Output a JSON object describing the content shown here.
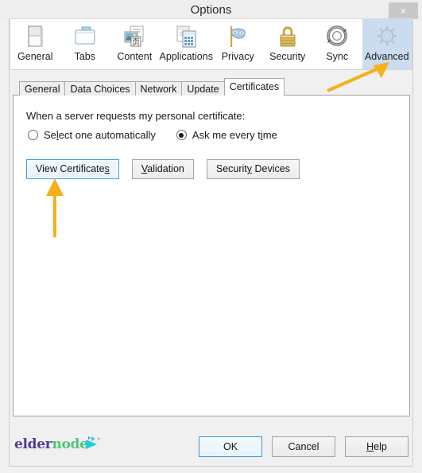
{
  "window": {
    "title": "Options",
    "close_label": "×"
  },
  "toolbar": {
    "items": [
      {
        "label": "General",
        "icon": "general-window-icon",
        "selected": false
      },
      {
        "label": "Tabs",
        "icon": "folder-tabs-icon",
        "selected": false
      },
      {
        "label": "Content",
        "icon": "content-page-icon",
        "selected": false
      },
      {
        "label": "Applications",
        "icon": "applications-grid-icon",
        "selected": false
      },
      {
        "label": "Privacy",
        "icon": "privacy-mask-icon",
        "selected": false
      },
      {
        "label": "Security",
        "icon": "security-padlock-icon",
        "selected": false
      },
      {
        "label": "Sync",
        "icon": "sync-arrows-icon",
        "selected": false
      },
      {
        "label": "Advanced",
        "icon": "advanced-gear-icon",
        "selected": true
      }
    ]
  },
  "tabs": {
    "items": [
      {
        "label": "General",
        "active": false
      },
      {
        "label": "Data Choices",
        "active": false
      },
      {
        "label": "Network",
        "active": false
      },
      {
        "label": "Update",
        "active": false
      },
      {
        "label": "Certificates",
        "active": true
      }
    ]
  },
  "panel": {
    "prompt": "When a server requests my personal certificate:",
    "radios": [
      {
        "label_pre": "Se",
        "accel": "l",
        "label_post": "ect one automatically",
        "checked": false
      },
      {
        "label_pre": "Ask me every t",
        "accel": "i",
        "label_post": "me",
        "checked": true
      }
    ],
    "buttons": [
      {
        "label_pre": "View Certificate",
        "accel": "s",
        "label_post": "",
        "focused": true
      },
      {
        "label_pre": "",
        "accel": "V",
        "label_post": "alidation",
        "focused": false
      },
      {
        "label_pre": "Securit",
        "accel": "y",
        "label_post": " Devices",
        "focused": false
      }
    ]
  },
  "footer": {
    "logo": {
      "part1": "elder",
      "part2": "node"
    },
    "buttons": [
      {
        "label_pre": "OK",
        "accel": "",
        "label_post": "",
        "default": true
      },
      {
        "label_pre": "Cancel",
        "accel": "",
        "label_post": "",
        "default": false
      },
      {
        "label_pre": "",
        "accel": "H",
        "label_post": "elp",
        "default": false
      }
    ]
  },
  "annotations": [
    {
      "name": "arrow-pointing-to-advanced-tab",
      "color": "#f5b01a",
      "direction": "up-right"
    },
    {
      "name": "arrow-pointing-to-view-certificates",
      "color": "#f5b01a",
      "direction": "up"
    }
  ],
  "colors": {
    "accent_blue": "#3c9ade",
    "selected_tool_bg": "#ccdcf0",
    "annotation_orange": "#f5b01a",
    "dialog_bg": "#f0f0f0"
  }
}
